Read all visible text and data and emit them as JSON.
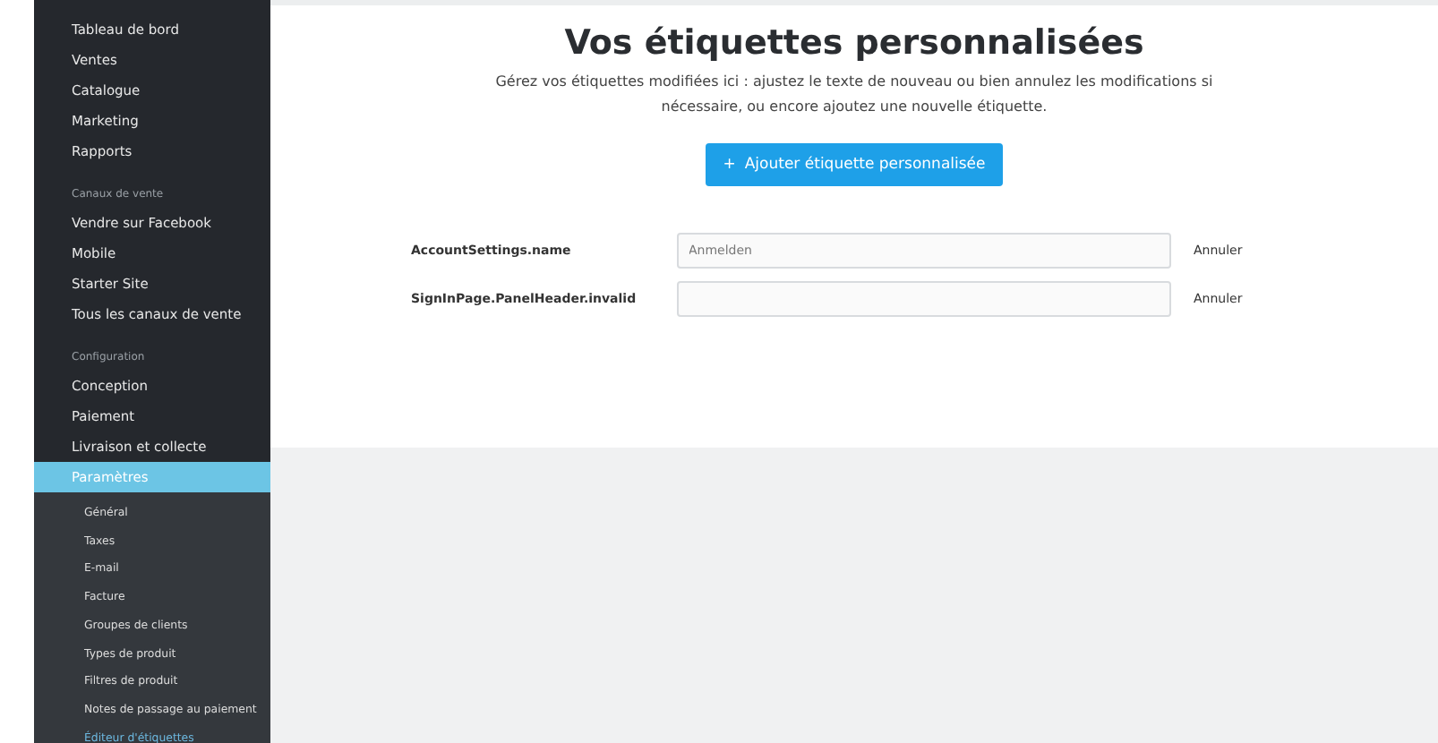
{
  "sidebar": {
    "sections": [
      {
        "items": [
          {
            "label": "Tableau de bord",
            "selected": false
          },
          {
            "label": "Ventes",
            "selected": false
          },
          {
            "label": "Catalogue",
            "selected": false
          },
          {
            "label": "Marketing",
            "selected": false
          },
          {
            "label": "Rapports",
            "selected": false
          }
        ]
      },
      {
        "title": "Canaux de vente",
        "items": [
          {
            "label": "Vendre sur Facebook",
            "selected": false
          },
          {
            "label": "Mobile",
            "selected": false
          },
          {
            "label": "Starter Site",
            "selected": false
          },
          {
            "label": "Tous les canaux de vente",
            "selected": false
          }
        ]
      },
      {
        "title": "Configuration",
        "items": [
          {
            "label": "Conception",
            "selected": false
          },
          {
            "label": "Paiement",
            "selected": false
          },
          {
            "label": "Livraison et collecte",
            "selected": false
          },
          {
            "label": "Paramètres",
            "selected": true,
            "children": [
              {
                "label": "Général",
                "selected": false
              },
              {
                "label": "Taxes",
                "selected": false
              },
              {
                "label": "E-mail",
                "selected": false
              },
              {
                "label": "Facture",
                "selected": false
              },
              {
                "label": "Groupes de clients",
                "selected": false
              },
              {
                "label": "Types de produit",
                "selected": false
              },
              {
                "label": "Filtres de produit",
                "selected": false
              },
              {
                "label": "Notes de passage au paiement",
                "selected": false
              },
              {
                "label": "Éditeur d'étiquettes",
                "selected": true
              }
            ]
          }
        ]
      }
    ]
  },
  "main": {
    "title": "Vos étiquettes personnalisées",
    "description": "Gérez vos étiquettes modifiées ici : ajustez le texte de nouveau ou bien annulez les modifications si nécessaire, ou encore ajoutez une nouvelle étiquette.",
    "add_button": {
      "icon": "+",
      "label": "Ajouter étiquette personnalisée"
    },
    "labels": [
      {
        "key": "AccountSettings.name",
        "value": "Anmelden",
        "cancel": "Annuler"
      },
      {
        "key": "SignInPage.PanelHeader.invalid",
        "cancel": "Annuler"
      }
    ]
  }
}
